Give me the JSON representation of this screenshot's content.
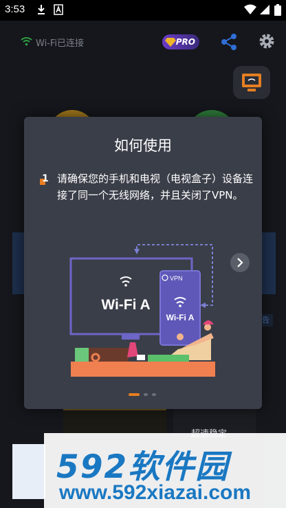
{
  "status_bar": {
    "time": "3:53"
  },
  "header": {
    "wifi_status": "Wi-Fi已连接",
    "pro_badge": "PRO"
  },
  "background": {
    "ad_tag": "告",
    "bottom_text": "超速稳定"
  },
  "dialog": {
    "title": "如何使用",
    "step_number": "1",
    "step_text": "请确保您的手机和电视（电视盒子）设备连接了同一个无线网络，并且关闭了VPN。",
    "illustration": {
      "tv_label": "Wi-Fi A",
      "phone_label": "Wi-Fi A",
      "vpn_label": "VPN"
    },
    "pager": {
      "page_count": 3,
      "current_page": 1
    }
  },
  "watermark": {
    "brand": "592软件园",
    "url": "www.592xiazai.com"
  },
  "colors": {
    "accent": "#e67e22",
    "dialog_bg": "#3a3e48",
    "illustration_purple": "#5f58b8",
    "watermark_blue": "#1a78c2"
  }
}
